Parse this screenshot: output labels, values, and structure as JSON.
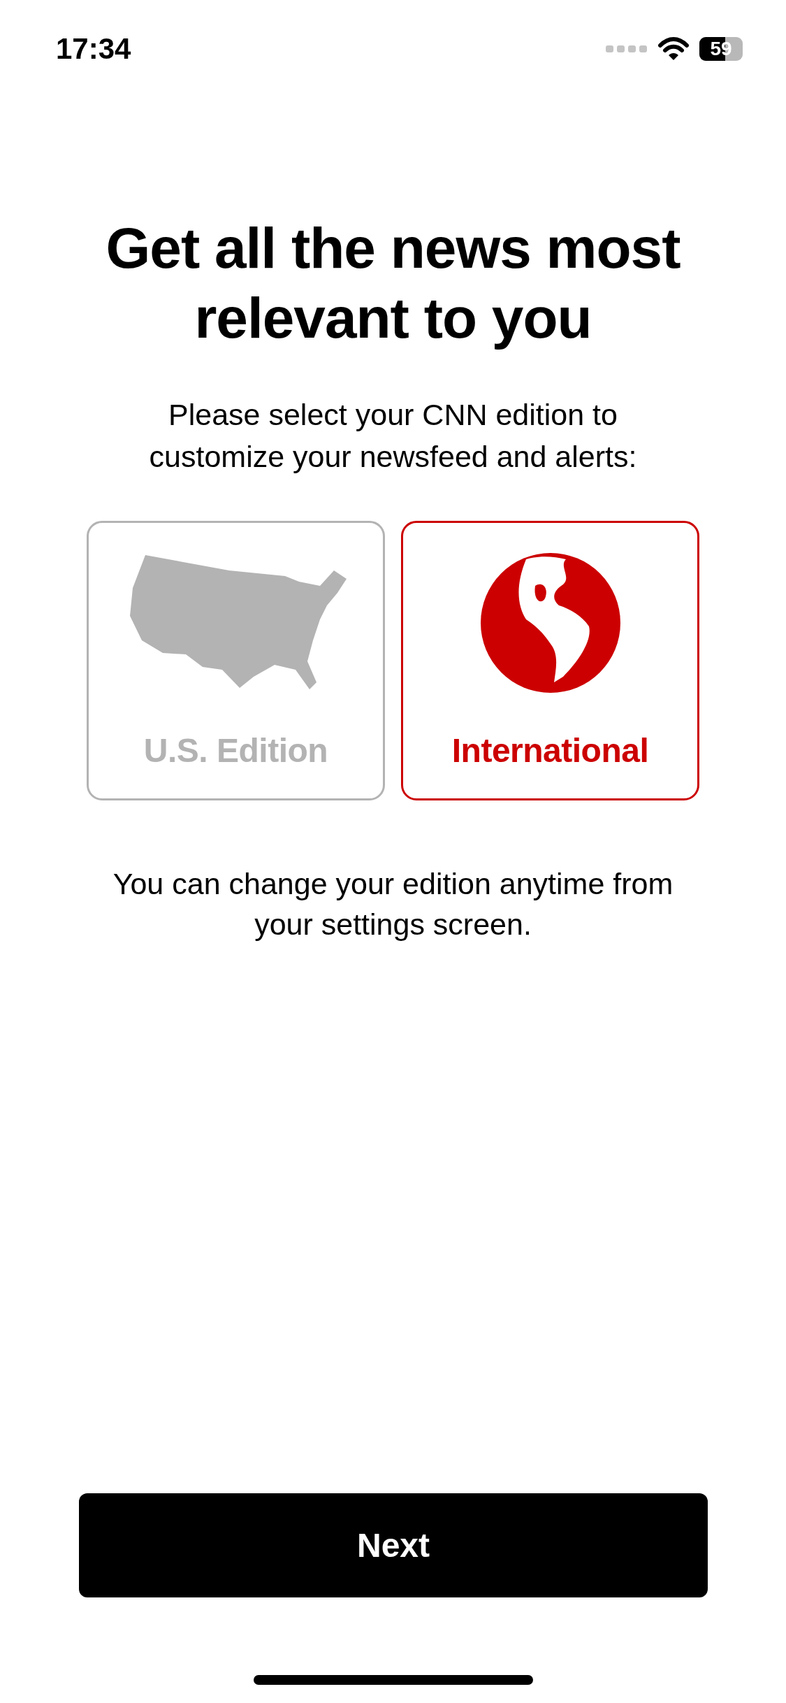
{
  "status_bar": {
    "time": "17:34",
    "battery": "59"
  },
  "title": "Get all the news most relevant to you",
  "subtitle": "Please select your CNN edition to customize your newsfeed and alerts:",
  "editions": [
    {
      "label": "U.S. Edition",
      "kind": "map",
      "selected": false
    },
    {
      "label": "International",
      "kind": "globe",
      "selected": true
    }
  ],
  "note": "You can change your edition anytime from your settings screen.",
  "next_button": "Next"
}
